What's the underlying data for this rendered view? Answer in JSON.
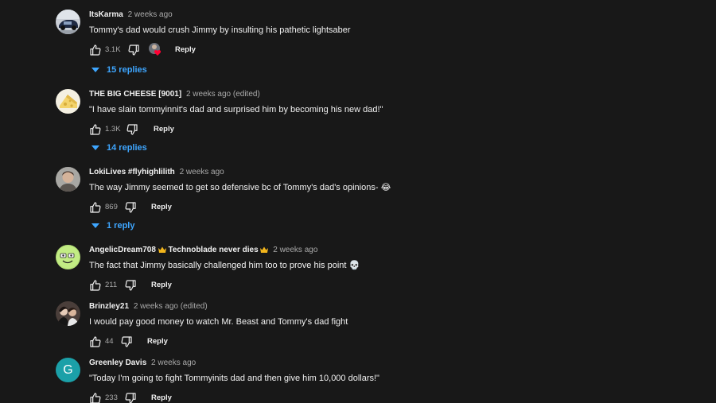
{
  "comments": [
    {
      "author": "ItsKarma",
      "time": "2 weeks ago",
      "text": "Tommy's dad would crush Jimmy by insulting his pathetic lightsaber",
      "likes": "3.1K",
      "reply_label": "Reply",
      "avatar_icon": "car-photo-avatar",
      "has_creator_heart": true,
      "replies_label": "15 replies"
    },
    {
      "author": "THE BIG CHEESE [9001]",
      "time": "2 weeks ago (edited)",
      "text": "\"I have slain tommyinnit's dad and surprised him by becoming his new dad!\"",
      "likes": "1.3K",
      "reply_label": "Reply",
      "avatar_icon": "cheese-avatar",
      "replies_label": "14 replies"
    },
    {
      "author": "LokiLives #flyhighlilith",
      "time": "2 weeks ago",
      "text": "The way Jimmy seemed to get so defensive bc of Tommy's dad's opinions-",
      "emoji": "😂",
      "likes": "869",
      "reply_label": "Reply",
      "avatar_icon": "person-photo-avatar",
      "replies_label": "1 reply"
    },
    {
      "author": "AngelicDream708",
      "badge": "Technoblade never dies",
      "time": "2 weeks ago",
      "text": "The fact that Jimmy basically challenged him too to prove his point",
      "emoji": "💀",
      "likes": "211",
      "reply_label": "Reply",
      "avatar_icon": "green-smiley-avatar"
    },
    {
      "author": "Brinzley21",
      "time": "2 weeks ago (edited)",
      "text": "I would pay good money to watch Mr. Beast and Tommy's dad fight",
      "likes": "44",
      "reply_label": "Reply",
      "avatar_icon": "two-people-photo-avatar"
    },
    {
      "author": "Greenley Davis",
      "time": "2 weeks ago",
      "text": "\"Today I'm going to fight Tommyinits dad and then give him 10,000 dollars!\"",
      "likes": "233",
      "reply_label": "Reply",
      "avatar_letter": "G",
      "avatar_color": "#1ba0a8"
    }
  ],
  "colors": {
    "background": "#181818",
    "primary_text": "#f1f1f1",
    "secondary_text": "#aaaaaa",
    "link_blue": "#3ea6ff",
    "heart_red": "#ff0033",
    "crown_gold": "#f2b51c"
  }
}
